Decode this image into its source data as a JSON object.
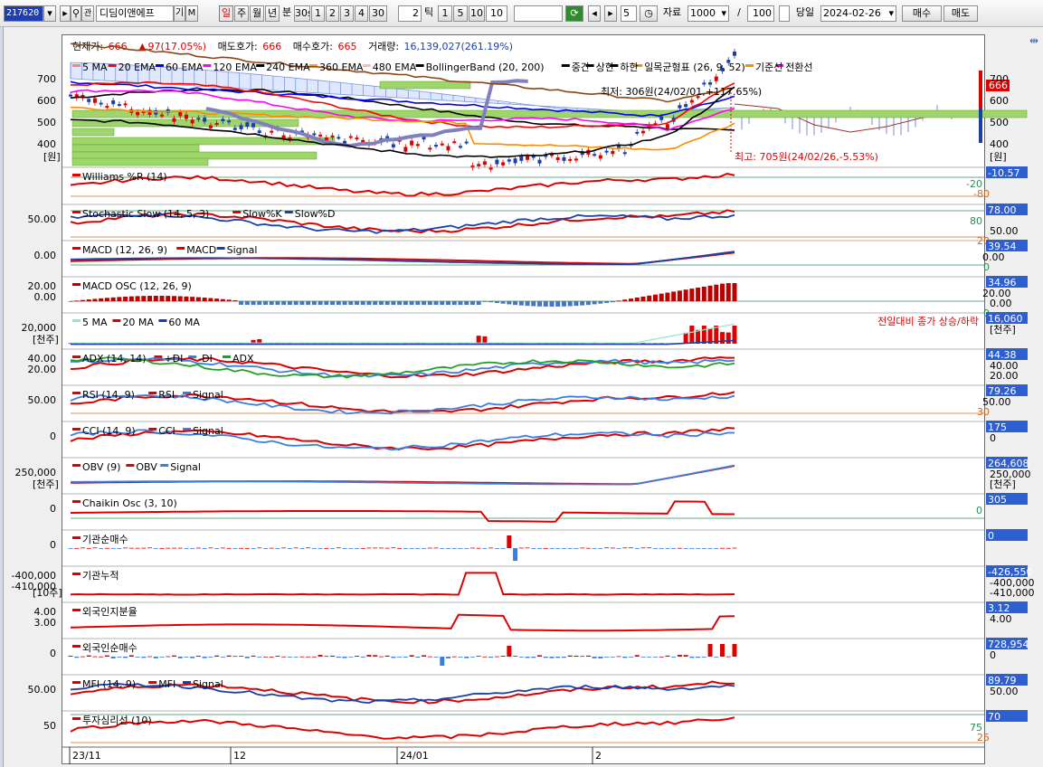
{
  "toolbar": {
    "code": "217620",
    "name": "디딤이앤에프",
    "gi_label": "기",
    "m_label": "M",
    "periods": [
      "일",
      "주",
      "월",
      "년",
      "분",
      "30s",
      "1",
      "2",
      "3",
      "4",
      "30"
    ],
    "tick_value": "2",
    "tick_label": "틱",
    "tick_nums": [
      "1",
      "5",
      "10",
      "10"
    ],
    "count_value": "5",
    "data_label": "자료",
    "data_count": "1000",
    "slash": "/",
    "page_count": "100",
    "today_label": "당일",
    "date": "2024-02-26",
    "buy_label": "매수",
    "sell_label": "매도"
  },
  "info": {
    "price_label": "현재가:",
    "price": "666",
    "change": "97(17.05%)",
    "ask_label": "매도호가:",
    "ask": "666",
    "bid_label": "매수호가:",
    "bid": "665",
    "volume_label": "거래량:",
    "volume": "16,139,027(261.19%)"
  },
  "main_legend": [
    "5 MA",
    "20 EMA",
    "60 EMA",
    "120 EMA",
    "240 EMA",
    "360 EMA",
    "480 EMA",
    "BollingerBand (20, 200)",
    "중간",
    "상한",
    "하한",
    "일목균형표 (26, 9, 52)",
    "기준선",
    "전환선"
  ],
  "main_legend_colors": [
    "#ff7f7f",
    "#ff0000",
    "#0000ff",
    "#ff00ff",
    "#000000",
    "#ffa500",
    "#ffb6c1",
    "#000000",
    "#000000",
    "#000000",
    "#000000",
    "#ff8c00",
    "#ff8c00",
    "#ff00ff"
  ],
  "main_annot": {
    "low": "최저: 306원(24/02/01,+117.65%)",
    "high": "최고: 705원(24/02/26,-5.53%)"
  },
  "main_axis": {
    "left_ticks": [
      "700",
      "600",
      "500",
      "400"
    ],
    "left_unit": "[원]",
    "right_ticks": [
      "700",
      "600",
      "500",
      "400"
    ],
    "right_unit": "[원]",
    "current": "666"
  },
  "panels": [
    {
      "title": "Williams %R (14)",
      "left": [],
      "right_tag": "-10.57",
      "right_extra": [
        "-20",
        "-80"
      ],
      "extra_colors": [
        "#2e8b57",
        "#d2691e"
      ]
    },
    {
      "title": "Stochastic Slow (14, 5, 3)",
      "legend": [
        "Slow%K",
        "Slow%D"
      ],
      "left": [
        "50.00"
      ],
      "right_tag": "78.00",
      "right_extra": [
        "80",
        "50.00",
        "20"
      ],
      "extra_colors": [
        "#2e8b57",
        "#000",
        "#d2691e"
      ]
    },
    {
      "title": "MACD (12, 26, 9)",
      "legend": [
        "MACD",
        "Signal"
      ],
      "left": [
        "0.00"
      ],
      "right_tag": "39.54",
      "right_extra": [
        "0.00",
        "0"
      ],
      "extra_colors": [
        "#000",
        "#2e8b57"
      ]
    },
    {
      "title": "MACD OSC (12, 26, 9)",
      "left": [
        "20.00",
        "0.00"
      ],
      "right_tag": "34.96",
      "right_extra": [
        "20.00",
        "0.00",
        "0"
      ],
      "extra_colors": [
        "#000",
        "#000",
        "#2e8b57"
      ]
    },
    {
      "title": "",
      "legend": [
        "5 MA",
        "20 MA",
        "60 MA"
      ],
      "left": [
        "20,000"
      ],
      "left_unit": "[천주]",
      "right_tag": "16,060",
      "right_extra": [
        "[천주]"
      ],
      "extra_colors": [
        "#000"
      ],
      "note": "전일대비 종가 상승/하락"
    },
    {
      "title": "ADX (14, 14)",
      "legend": [
        "+DI",
        "-DI",
        "ADX"
      ],
      "left": [
        "40.00",
        "20.00"
      ],
      "right_tag": "44.38",
      "right_extra": [
        "40.00",
        "20.00"
      ],
      "extra_colors": [
        "#000",
        "#000"
      ]
    },
    {
      "title": "RSI (14, 9)",
      "legend": [
        "RSI",
        "Signal"
      ],
      "left": [
        "50.00"
      ],
      "right_tag": "79.26",
      "right_extra": [
        "50.00",
        "30"
      ],
      "extra_colors": [
        "#000",
        "#d2691e"
      ]
    },
    {
      "title": "CCI (14, 9)",
      "legend": [
        "CCI",
        "Signal"
      ],
      "left": [
        "0"
      ],
      "right_tag": "175",
      "right_extra": [
        "0"
      ],
      "extra_colors": [
        "#000"
      ]
    },
    {
      "title": "OBV (9)",
      "legend": [
        "OBV",
        "Signal"
      ],
      "left": [
        "250,000"
      ],
      "left_unit": "[천주]",
      "right_tag": "264,608",
      "right_extra": [
        "250,000",
        "[천주]"
      ],
      "extra_colors": [
        "#000",
        "#000"
      ]
    },
    {
      "title": "Chaikin Osc (3, 10)",
      "left": [
        "0"
      ],
      "right_tag": "305",
      "right_extra": [
        "0"
      ],
      "extra_colors": [
        "#2e8b57"
      ]
    },
    {
      "title": "기관순매수",
      "left": [
        "0"
      ],
      "right_tag": "0",
      "right_extra": [],
      "extra_colors": []
    },
    {
      "title": "기관누적",
      "left": [
        "-400,000",
        "-410,000"
      ],
      "left_unit": "[10주]",
      "right_tag": "-426,550",
      "right_extra": [
        "-400,000",
        "-410,000"
      ],
      "extra_colors": [
        "#000",
        "#000"
      ]
    },
    {
      "title": "외국인지분율",
      "left": [
        "4.00",
        "3.00"
      ],
      "right_tag": "3.12",
      "right_extra": [
        "4.00"
      ],
      "extra_colors": [
        "#000"
      ]
    },
    {
      "title": "외국인순매수",
      "left": [
        "0"
      ],
      "right_tag": "728,954",
      "right_extra": [
        "0"
      ],
      "extra_colors": [
        "#000"
      ]
    },
    {
      "title": "MFI (14, 9)",
      "legend": [
        "MFI",
        "Signal"
      ],
      "left": [
        "50.00"
      ],
      "right_tag": "89.79",
      "right_extra": [
        "50.00"
      ],
      "extra_colors": [
        "#000"
      ]
    },
    {
      "title": "투자심리선 (10)",
      "left": [
        "50"
      ],
      "right_tag": "70",
      "right_extra": [
        "75",
        "25"
      ],
      "extra_colors": [
        "#2e8b57",
        "#d2691e"
      ]
    }
  ],
  "date_labels": [
    "23/11",
    "12",
    "24/01",
    "2"
  ],
  "colors": {
    "tag_bg": "#2e5fd0",
    "up": "#dd0000",
    "down": "#1a3fa8",
    "grid": "#d6d6d6"
  }
}
